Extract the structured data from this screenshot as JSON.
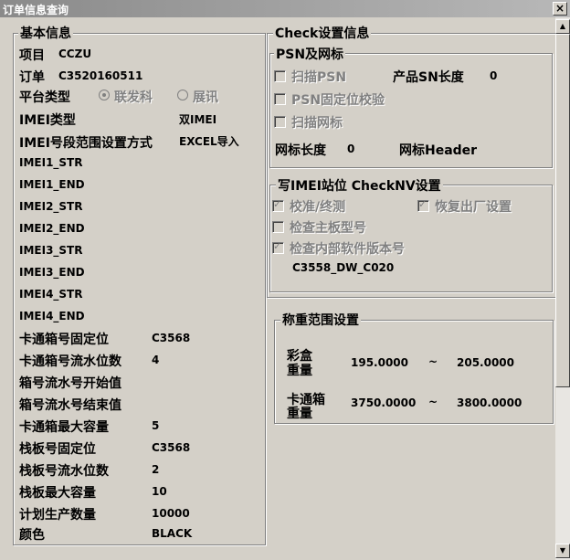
{
  "window": {
    "title": "订单信息查询",
    "close": "×"
  },
  "basic": {
    "legend": "基本信息",
    "project_label": "项目",
    "project_value": "CCZU",
    "order_label": "订单",
    "order_value": "C3520160511",
    "platform_label": "平台类型",
    "platform_opt1": "联发科",
    "platform_opt2": "展讯",
    "imei_type_label": "IMEI类型",
    "imei_type_value": "双IMEI",
    "imei_range_label": "IMEI号段范围设置方式",
    "imei_range_value": "EXCEL导入",
    "imei_fields": [
      "IMEI1_STR",
      "IMEI1_END",
      "IMEI2_STR",
      "IMEI2_END",
      "IMEI3_STR",
      "IMEI3_END",
      "IMEI4_STR",
      "IMEI4_END"
    ],
    "carton_fixed_label": "卡通箱号固定位",
    "carton_fixed_value": "C3568",
    "carton_serial_label": "卡通箱号流水位数",
    "carton_serial_value": "4",
    "box_serial_start_label": "箱号流水号开始值",
    "box_serial_end_label": "箱号流水号结束值",
    "carton_max_label": "卡通箱最大容量",
    "carton_max_value": "5",
    "pallet_fixed_label": "栈板号固定位",
    "pallet_fixed_value": "C3568",
    "pallet_serial_label": "栈板号流水位数",
    "pallet_serial_value": "2",
    "pallet_max_label": "栈板最大容量",
    "pallet_max_value": "10",
    "plan_qty_label": "计划生产数量",
    "plan_qty_value": "10000",
    "color_label": "颜色",
    "color_value": "BLACK"
  },
  "check": {
    "legend": "Check设置信息",
    "psn": {
      "legend": "PSN及网标",
      "scan_psn": "扫描PSN",
      "sn_len_label": "产品SN长度",
      "sn_len_value": "0",
      "psn_fixed": "PSN固定位校验",
      "scan_mark": "扫描网标",
      "mark_len_label": "网标长度",
      "mark_len_value": "0",
      "mark_header_label": "网标Header"
    },
    "imei": {
      "legend": "写IMEI站位 CheckNV设置",
      "calib": "校准/终测",
      "factory_reset": "恢复出厂设置",
      "check_board": "检查主板型号",
      "check_sw": "检查内部软件版本号",
      "sw_version": "C3558_DW_C020"
    }
  },
  "weight": {
    "legend": "称重范围设置",
    "color_box_label_1": "彩盒",
    "color_box_label_2": "重量",
    "color_box_min": "195.0000",
    "color_box_tilde": "~",
    "color_box_max": "205.0000",
    "carton_label_1": "卡通箱",
    "carton_label_2": "重量",
    "carton_min": "3750.0000",
    "carton_tilde": "~",
    "carton_max": "3800.0000"
  },
  "scrollbar": {
    "up": "▲",
    "down": "▼"
  }
}
